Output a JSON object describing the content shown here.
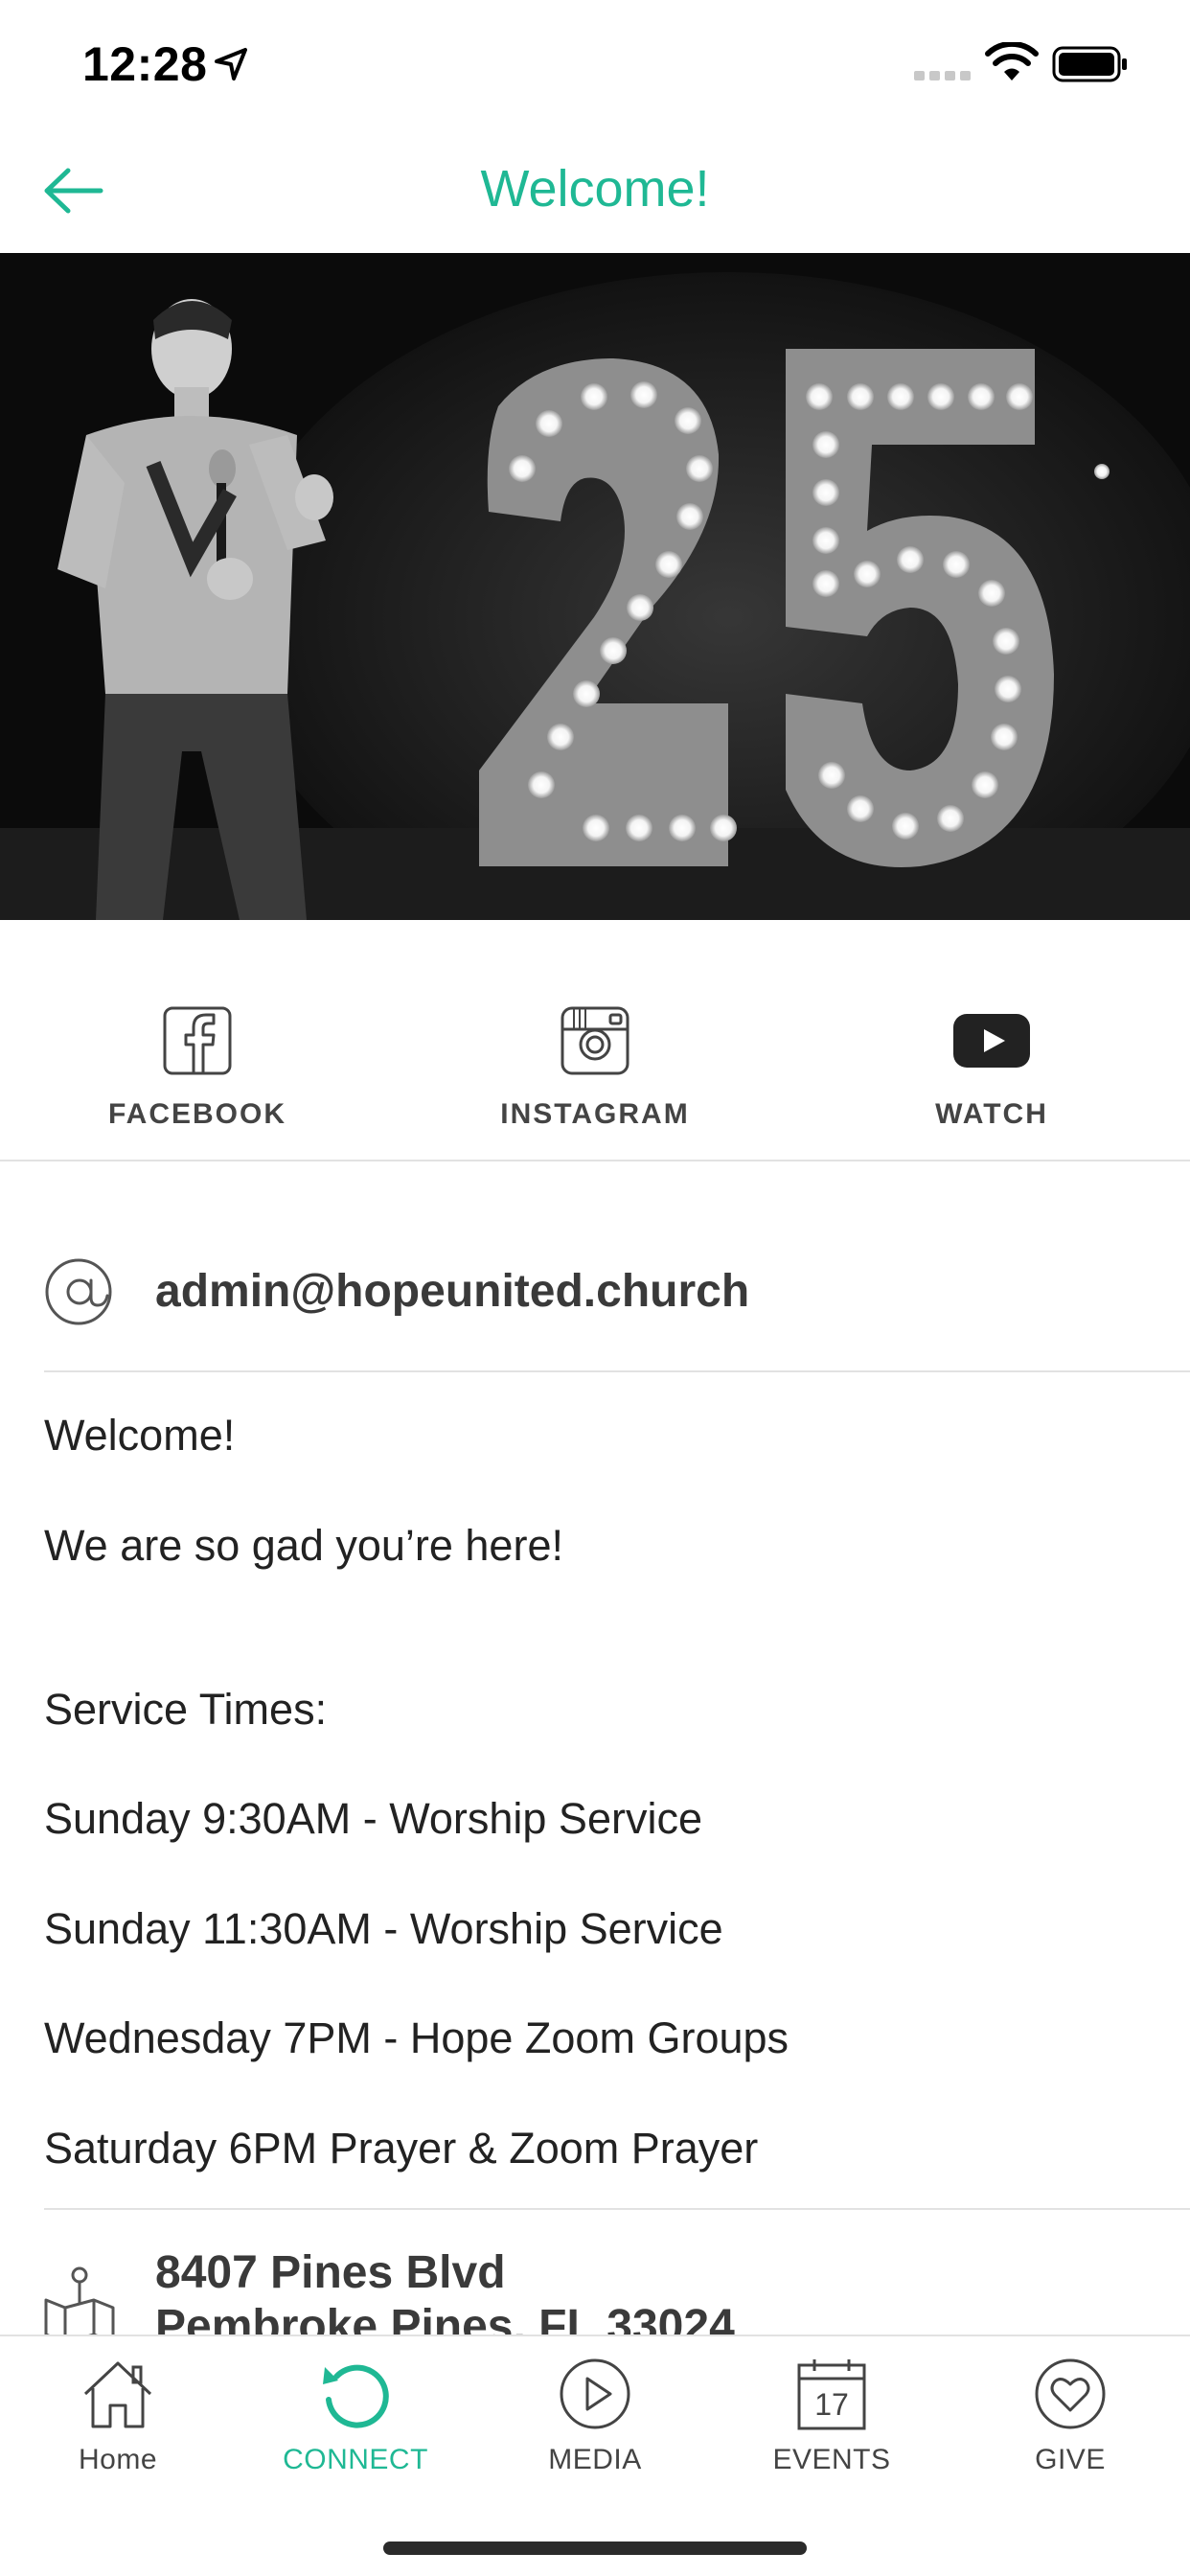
{
  "status_bar": {
    "time": "12:28"
  },
  "header": {
    "title": "Welcome!"
  },
  "social": [
    {
      "label": "FACEBOOK",
      "icon": "facebook-icon"
    },
    {
      "label": "INSTAGRAM",
      "icon": "instagram-icon"
    },
    {
      "label": "WATCH",
      "icon": "youtube-icon"
    }
  ],
  "contact": {
    "email": "admin@hopeunited.church"
  },
  "description": {
    "lines": [
      "Welcome!",
      "We are so gad you’re here!",
      "Service Times:",
      "Sunday 9:30AM - Worship Service",
      "Sunday 11:30AM - Worship Service",
      "Wednesday 7PM - Hope Zoom Groups",
      "Saturday 6PM Prayer & Zoom Prayer"
    ]
  },
  "address": {
    "line1": "8407 Pines Blvd",
    "line2": "Pembroke Pines, FL 33024"
  },
  "tabs": [
    {
      "label": "Home",
      "icon": "home-icon",
      "active": false
    },
    {
      "label": "CONNECT",
      "icon": "connect-icon",
      "active": true
    },
    {
      "label": "MEDIA",
      "icon": "media-play-icon",
      "active": false
    },
    {
      "label": "EVENTS",
      "icon": "calendar-icon",
      "active": false,
      "calendar_day": "17"
    },
    {
      "label": "GIVE",
      "icon": "heart-icon",
      "active": false
    }
  ],
  "colors": {
    "accent": "#1fb894",
    "text": "#222222",
    "icon": "#444444",
    "divider": "#e2e2e2"
  }
}
